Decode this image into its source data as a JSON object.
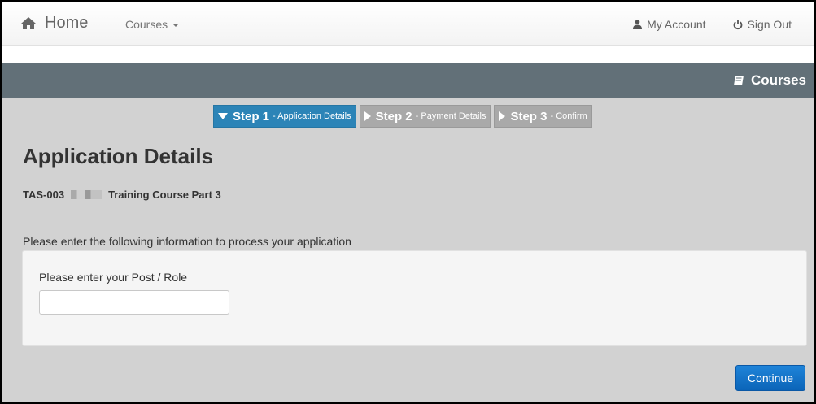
{
  "navbar": {
    "home_label": "Home",
    "courses_label": "Courses",
    "my_account_label": "My Account",
    "sign_out_label": "Sign Out"
  },
  "section_bar": {
    "title": "Courses"
  },
  "steps": [
    {
      "label": "Step 1",
      "sub": "- Application Details",
      "active": true
    },
    {
      "label": "Step 2",
      "sub": "- Payment Details",
      "active": false
    },
    {
      "label": "Step 3",
      "sub": "- Confirm",
      "active": false
    }
  ],
  "page": {
    "heading": "Application Details",
    "course_code": "TAS-003",
    "course_name": "Training Course Part 3",
    "instructions": "Please enter the following information to process your application"
  },
  "form": {
    "post_role_label": "Please enter your Post / Role",
    "post_role_value": ""
  },
  "actions": {
    "continue_label": "Continue"
  },
  "colors": {
    "section_bar": "#627078",
    "step_active": "#2c84b7",
    "step_inactive": "#a9a9a9",
    "primary_button": "#1174cb",
    "page_background": "#d2d2d2"
  }
}
